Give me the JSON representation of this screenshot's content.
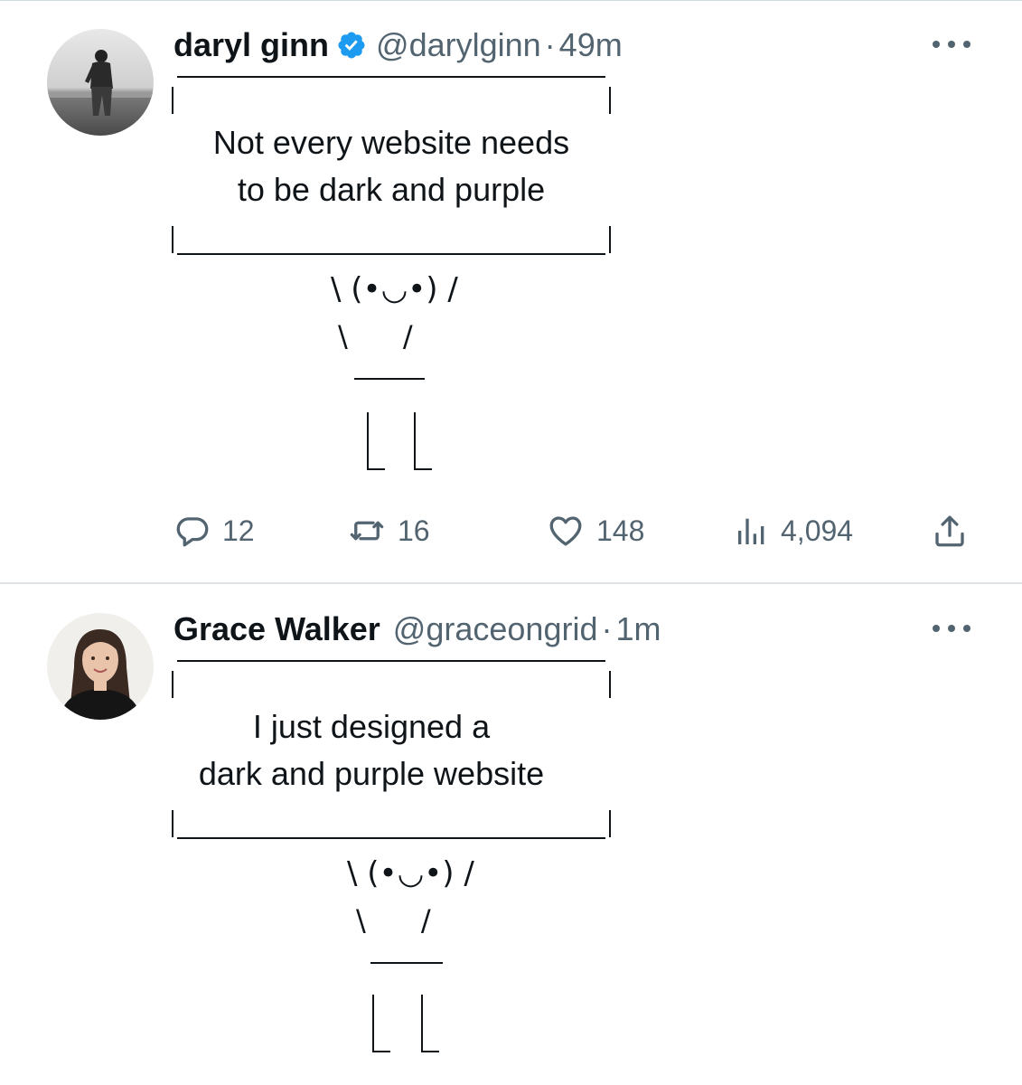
{
  "tweets": [
    {
      "display_name": "daryl ginn",
      "verified": true,
      "handle": "@darylginn",
      "separator": "·",
      "time": "49m",
      "sign_lines": [
        "Not every website needs",
        "to be dark and purple"
      ],
      "face": "\\ (•◡•) /",
      "arms": "\\      /",
      "replies": "12",
      "reposts": "16",
      "likes": "148",
      "views": "4,094"
    },
    {
      "display_name": "Grace Walker",
      "verified": false,
      "handle": "@graceongrid",
      "separator": "·",
      "time": "1m",
      "sign_lines": [
        "I just designed a",
        "dark and purple website"
      ],
      "face": "\\ (•◡•) /",
      "arms": "\\      /"
    }
  ],
  "icons": {
    "verified": "verified-badge-icon",
    "more": "more-options-icon",
    "reply": "reply-icon",
    "repost": "repost-icon",
    "like": "like-icon",
    "views": "views-icon",
    "share": "share-icon"
  },
  "colors": {
    "text_primary": "#0f1419",
    "text_secondary": "#536471",
    "verified_blue": "#1d9bf0",
    "divider": "#dfe3e6"
  }
}
